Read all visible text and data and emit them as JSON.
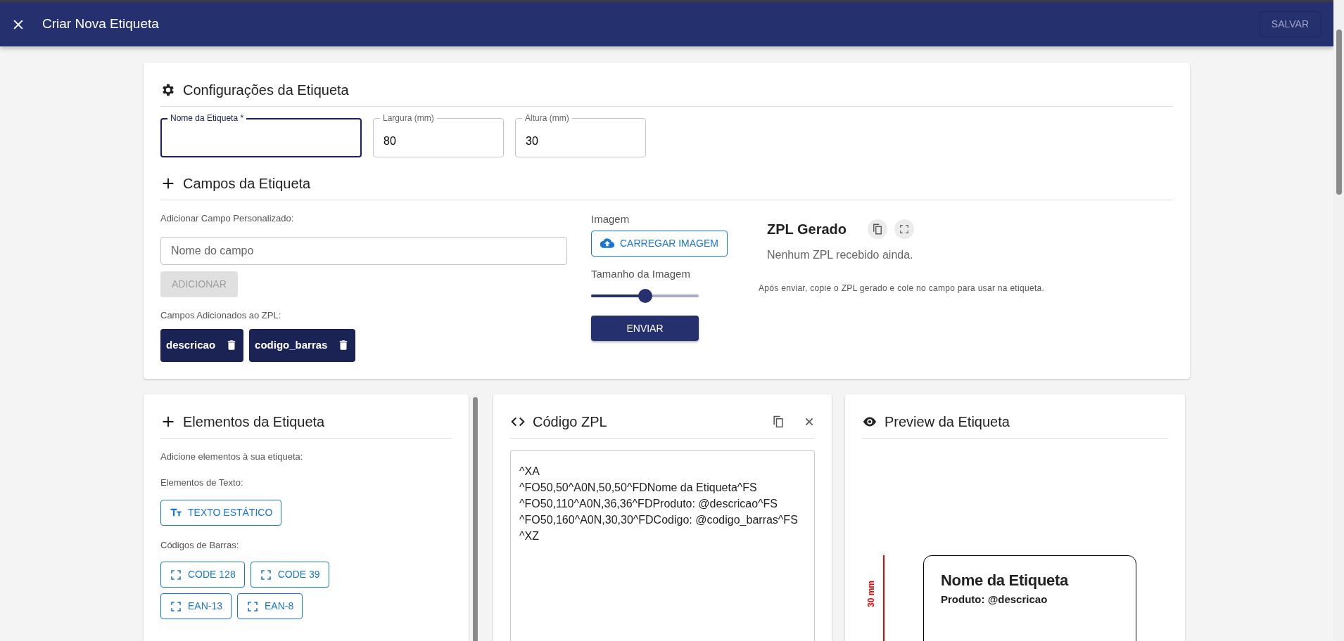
{
  "app_bar": {
    "title": "Criar Nova Etiqueta",
    "save_button": {
      "label": "SALVAR",
      "disabled": true
    }
  },
  "settings": {
    "title": "Configurações da Etiqueta",
    "fields": [
      {
        "label": "Nome da Etiqueta *",
        "focused": true
      },
      {
        "label": "Largura (mm)",
        "value": "80",
        "focused": false
      },
      {
        "label": "Altura (mm)",
        "value": "30",
        "focused": false
      }
    ]
  },
  "fields_section": {
    "title": "Campos da Etiqueta",
    "custom_label": "Adicionar Campo Personalizado:",
    "custom_input": {
      "placeholder": "Nome do campo"
    },
    "add_button": {
      "label": "ADICIONAR",
      "disabled": true
    },
    "added_label": "Campos Adicionados ao ZPL:",
    "added_fields": [
      "descricao",
      "codigo_barras"
    ]
  },
  "image": {
    "label": "Imagem",
    "upload_button": "CARREGAR IMAGEM",
    "size_label": "Tamanho da Imagem",
    "size": {
      "level": 0.5
    },
    "send_button": "ENVIAR"
  },
  "zpl_generated": {
    "title": "ZPL Gerado",
    "status": "Nenhum ZPL recebido ainda.",
    "hint": "Após enviar, copie o ZPL gerado e cole no campo para usar na etiqueta."
  },
  "elements": {
    "title": "Elementos da Etiqueta",
    "intro": "Adicione elementos à sua etiqueta:",
    "groups": [
      {
        "label": "Elementos de Texto:",
        "buttons": [
          {
            "label": "TEXTO ESTÁTICO",
            "kind": "text"
          }
        ]
      },
      {
        "label": "Códigos de Barras:",
        "buttons": [
          {
            "label": "CODE 128",
            "kind": "barcode"
          },
          {
            "label": "CODE 39",
            "kind": "barcode"
          },
          {
            "label": "EAN-13",
            "kind": "barcode"
          },
          {
            "label": "EAN-8",
            "kind": "barcode"
          }
        ]
      }
    ]
  },
  "zpl_code": {
    "title": "Código ZPL",
    "lines": [
      "^XA",
      "^FO50,50^A0N,50,50^FDNome da Etiqueta^FS",
      "^FO50,110^A0N,36,36^FDProduto: @descricao^FS",
      "^FO50,160^A0N,30,30^FDCodigo: @codigo_barras^FS",
      "^XZ"
    ]
  },
  "preview": {
    "title": "Preview da Etiqueta",
    "height_label": "30 mm",
    "label": {
      "title": "Nome da Etiqueta",
      "lines": [
        "Produto: @descricao"
      ]
    }
  }
}
